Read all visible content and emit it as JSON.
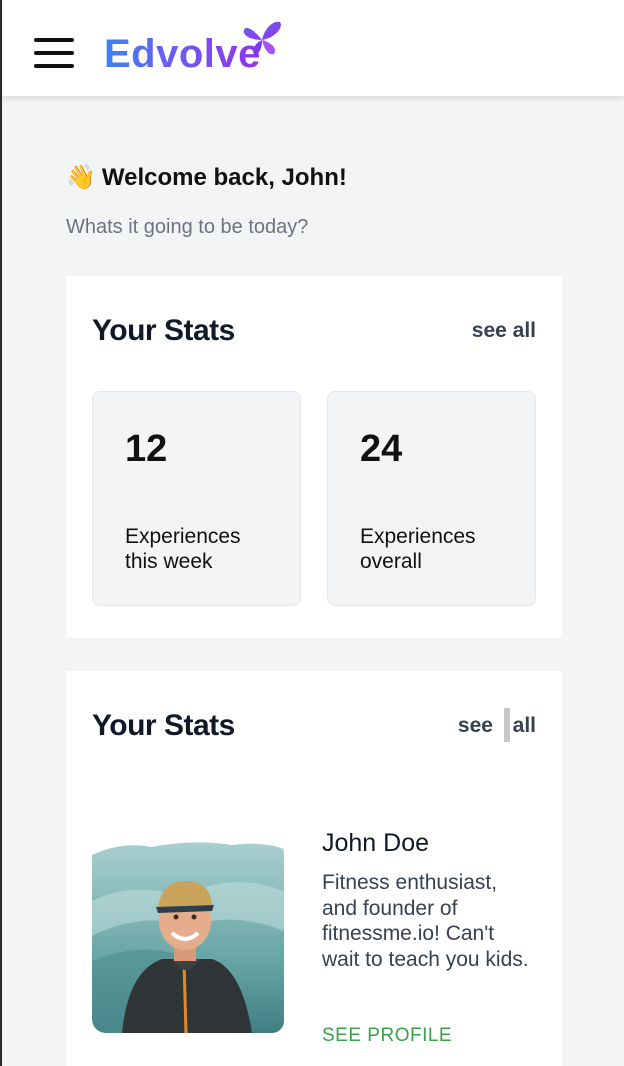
{
  "header": {
    "brand": "Edvolve",
    "menu_icon": "hamburger-menu-icon",
    "logo_icon": "butterfly-icon",
    "brand_colors": [
      "#3b82f6",
      "#6d5cf0",
      "#9333ea"
    ]
  },
  "welcome": {
    "emoji": "👋",
    "title": "Welcome back, John!",
    "subtitle": "Whats it going to be today?"
  },
  "stats_card": {
    "title": "Your Stats",
    "see_all": "see all",
    "stats": [
      {
        "value": "12",
        "label": "Experiences this week"
      },
      {
        "value": "24",
        "label": "Experiences overall"
      }
    ]
  },
  "profile_card": {
    "title": "Your Stats",
    "see_all_left": "see",
    "see_all_right": "all",
    "name": "John Doe",
    "bio": "Fitness enthusiast, and founder of fitnessme.io! Can't wait to teach you kids.",
    "link": "SEE PROFILE",
    "link_color": "#3aa04b"
  }
}
